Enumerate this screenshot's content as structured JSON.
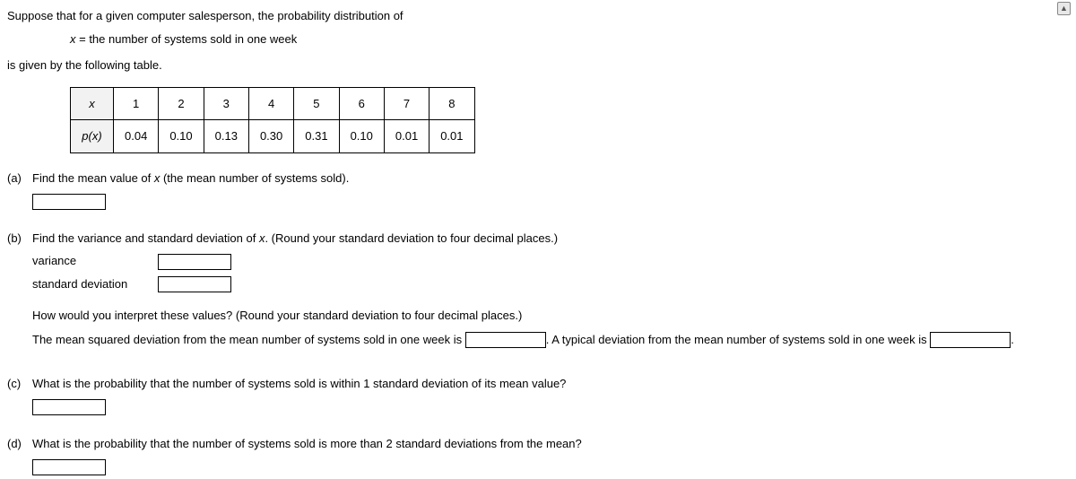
{
  "scroll": {
    "icon": "▲"
  },
  "intro": {
    "line1": "Suppose that for a given computer salesperson, the probability distribution of",
    "xdef_pre": "x",
    "xdef_rest": " = the number of systems sold in one week",
    "line2": "is given by the following table."
  },
  "table": {
    "row1_header": "x",
    "row1": [
      "1",
      "2",
      "3",
      "4",
      "5",
      "6",
      "7",
      "8"
    ],
    "row2_header": "p(x)",
    "row2": [
      "0.04",
      "0.10",
      "0.13",
      "0.30",
      "0.31",
      "0.10",
      "0.01",
      "0.01"
    ]
  },
  "parts": {
    "a": {
      "label": "(a)",
      "q_pre": "Find the mean value of ",
      "q_var": "x",
      "q_post": " (the mean number of systems sold)."
    },
    "b": {
      "label": "(b)",
      "q_pre": "Find the variance and standard deviation of ",
      "q_var": "x",
      "q_post": ". (Round your standard deviation to four decimal places.)",
      "var_label": "variance",
      "sd_label": "standard deviation",
      "interp_q": "How would you interpret these values? (Round your standard deviation to four decimal places.)",
      "interp_sent1": "The mean squared deviation from the mean number of systems sold in one week is ",
      "interp_mid": ". A typical deviation from the mean number of systems sold in one week is ",
      "interp_end": "."
    },
    "c": {
      "label": "(c)",
      "q": "What is the probability that the number of systems sold is within 1 standard deviation of its mean value?"
    },
    "d": {
      "label": "(d)",
      "q": "What is the probability that the number of systems sold is more than 2 standard deviations from the mean?"
    }
  }
}
